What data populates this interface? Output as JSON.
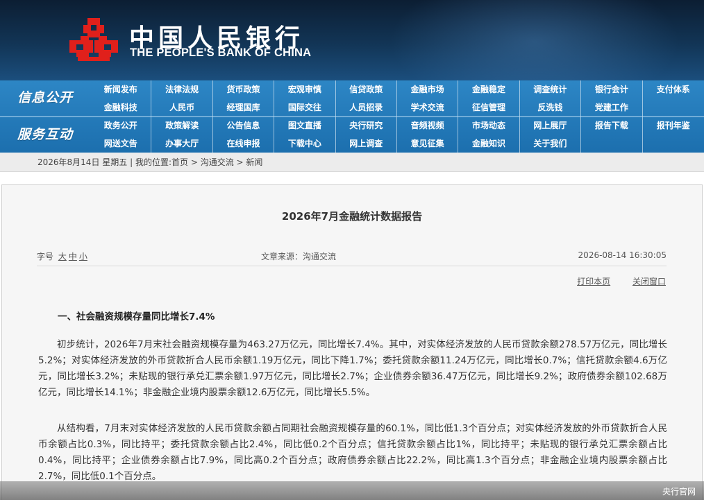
{
  "header": {
    "bank_name_cn": "中国人民银行",
    "bank_name_en": "THE PEOPLE'S BANK OF CHINA",
    "logo_icon": "pboc-logo-icon",
    "logo_color": "#e0201b"
  },
  "nav": {
    "sections": [
      {
        "label": "信息公开",
        "items": [
          "新闻发布",
          "法律法规",
          "货币政策",
          "宏观审慎",
          "信贷政策",
          "金融市场",
          "金融稳定",
          "调查统计",
          "银行会计",
          "支付体系",
          "金融科技",
          "人民币",
          "经理国库",
          "国际交往",
          "人员招录",
          "学术交流",
          "征信管理",
          "反洗钱",
          "党建工作",
          ""
        ]
      },
      {
        "label": "服务互动",
        "items": [
          "政务公开",
          "政策解读",
          "公告信息",
          "图文直播",
          "央行研究",
          "音频视频",
          "市场动态",
          "网上展厅",
          "报告下载",
          "报刊年鉴",
          "网送文告",
          "办事大厅",
          "在线申报",
          "下载中心",
          "网上调查",
          "意见征集",
          "金融知识",
          "关于我们",
          "",
          ""
        ]
      }
    ]
  },
  "infobar": {
    "date": "2026年8月14日 星期五",
    "separator": " | ",
    "location_label": "我的位置:",
    "crumbs": [
      "首页",
      "沟通交流",
      "新闻"
    ],
    "crumb_sep": " > "
  },
  "article": {
    "title": "2026年7月金融统计数据报告",
    "font_size_label": "字号",
    "font_sizes": [
      "大",
      "中",
      "小"
    ],
    "source": "文章来源：沟通交流",
    "datetime": "2026-08-14 16:30:05",
    "print_label": "打印本页",
    "close_label": "关闭窗口",
    "section_heading": "一、社会融资规模存量同比增长7.4%",
    "paragraphs": [
      "初步统计，2026年7月末社会融资规模存量为463.27万亿元，同比增长7.4%。其中，对实体经济发放的人民币贷款余额278.57万亿元，同比增长5.2%；对实体经济发放的外币贷款折合人民币余额1.19万亿元，同比下降1.7%；委托贷款余额11.24万亿元，同比增长0.7%；信托贷款余额4.6万亿元，同比增长3.2%；未贴现的银行承兑汇票余额1.97万亿元，同比增长2.7%；企业债券余额36.47万亿元，同比增长9.2%；政府债券余额102.68万亿元，同比增长14.1%；非金融企业境内股票余额12.6万亿元，同比增长5.5%。",
      "从结构看，7月末对实体经济发放的人民币贷款余额占同期社会融资规模存量的60.1%，同比低1.3个百分点；对实体经济发放的外币贷款折合人民币余额占比0.3%，同比持平；委托贷款余额占比2.4%，同比低0.2个百分点；信托贷款余额占比1%，同比持平；未贴现的银行承兑汇票余额占比0.4%，同比持平；企业债券余额占比7.9%，同比高0.2个百分点；政府债券余额占比22.2%，同比高1.3个百分点；非金融企业境内股票余额占比2.7%，同比低0.1个百分点。"
    ]
  },
  "watermark": {
    "text": "央行官网"
  }
}
